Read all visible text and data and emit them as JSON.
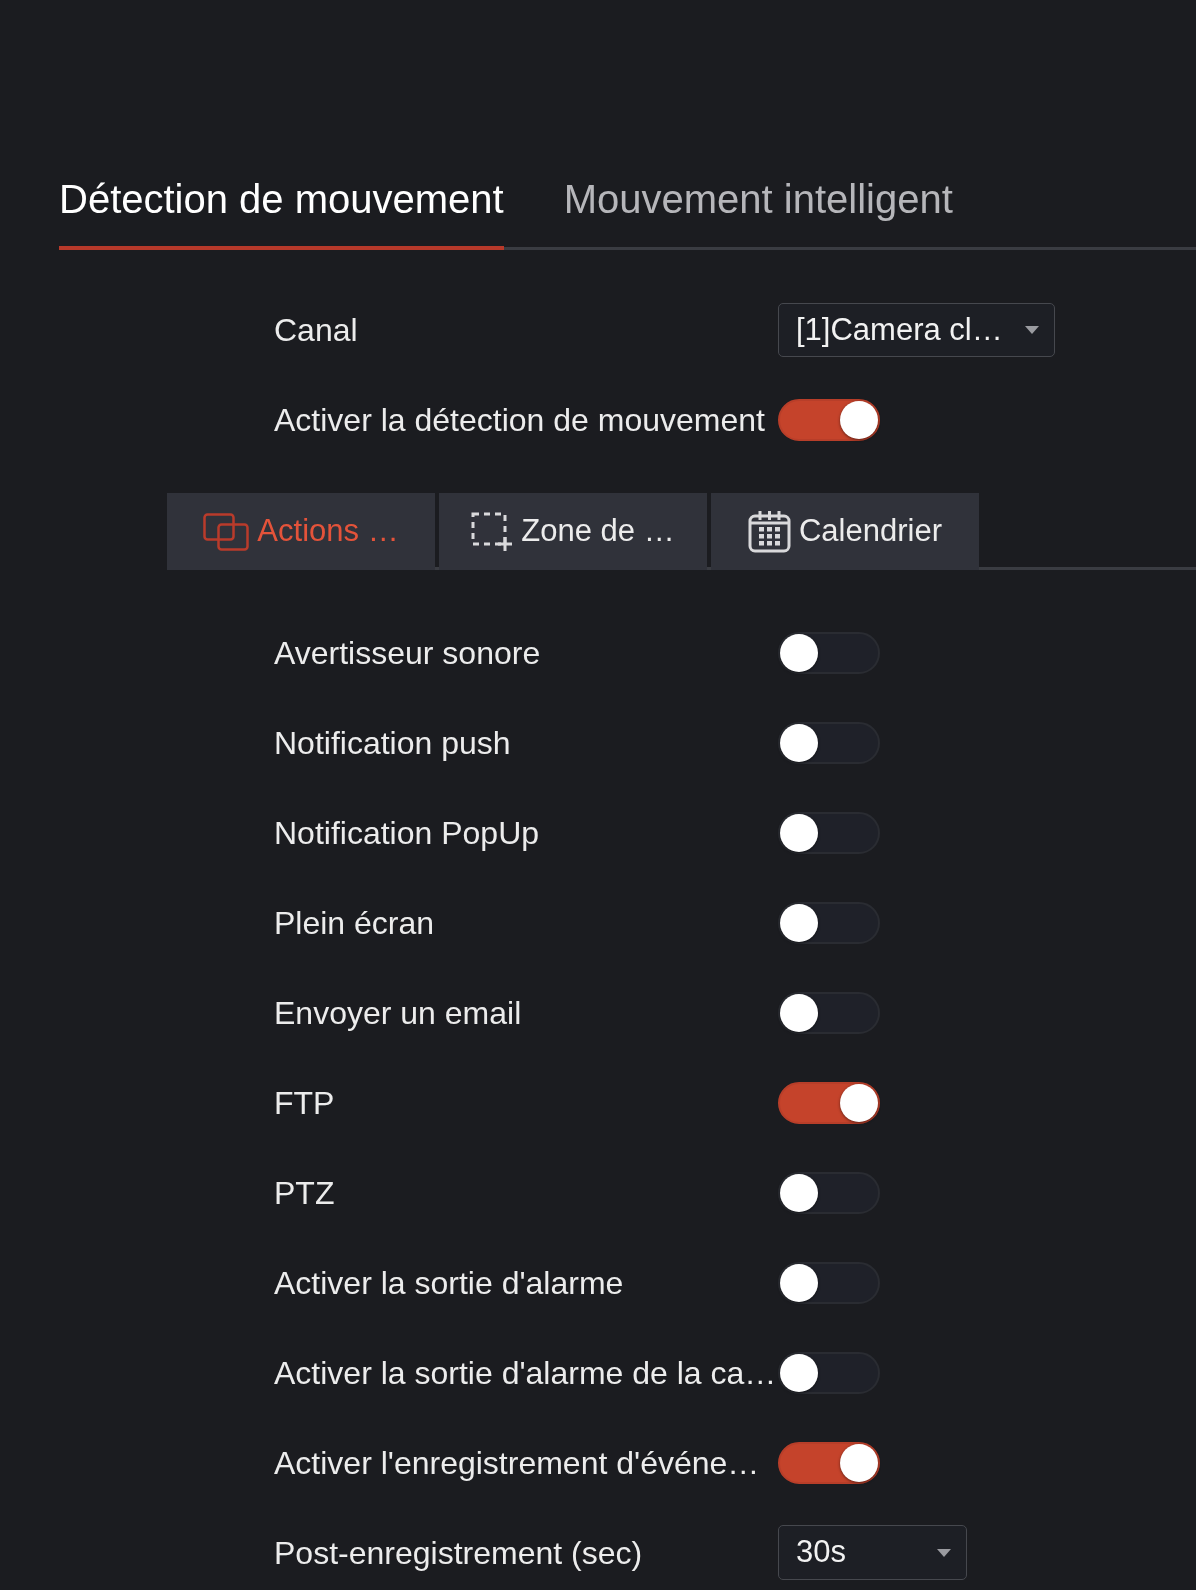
{
  "tabs": [
    {
      "label": "Détection de mouvement",
      "selected": true
    },
    {
      "label": "Mouvement intelligent",
      "selected": false
    }
  ],
  "channel": {
    "label": "Canal",
    "value": "[1]Camera cl…"
  },
  "motion_detection": {
    "label": "Activer la détection de mouvement",
    "on": true
  },
  "sub_tabs": [
    {
      "label": "Actions …",
      "selected": true
    },
    {
      "label": "Zone de …",
      "selected": false
    },
    {
      "label": "Calendrier",
      "selected": false
    }
  ],
  "actions": [
    {
      "kind": "toggle",
      "label": "Avertisseur sonore",
      "on": false
    },
    {
      "kind": "toggle",
      "label": "Notification push",
      "on": false
    },
    {
      "kind": "toggle",
      "label": "Notification PopUp",
      "on": false
    },
    {
      "kind": "toggle",
      "label": "Plein écran",
      "on": false
    },
    {
      "kind": "toggle",
      "label": "Envoyer un email",
      "on": false
    },
    {
      "kind": "toggle",
      "label": "FTP",
      "on": true
    },
    {
      "kind": "toggle",
      "label": "PTZ",
      "on": false
    },
    {
      "kind": "toggle",
      "label": "Activer la sortie d'alarme",
      "on": false
    },
    {
      "kind": "toggle",
      "label": "Activer la sortie d'alarme de la ca…",
      "on": false
    },
    {
      "kind": "toggle",
      "label": "Activer l'enregistrement d'événe…",
      "on": true
    },
    {
      "kind": "select",
      "label": "Post-enregistrement (sec)",
      "value": "30s"
    }
  ]
}
